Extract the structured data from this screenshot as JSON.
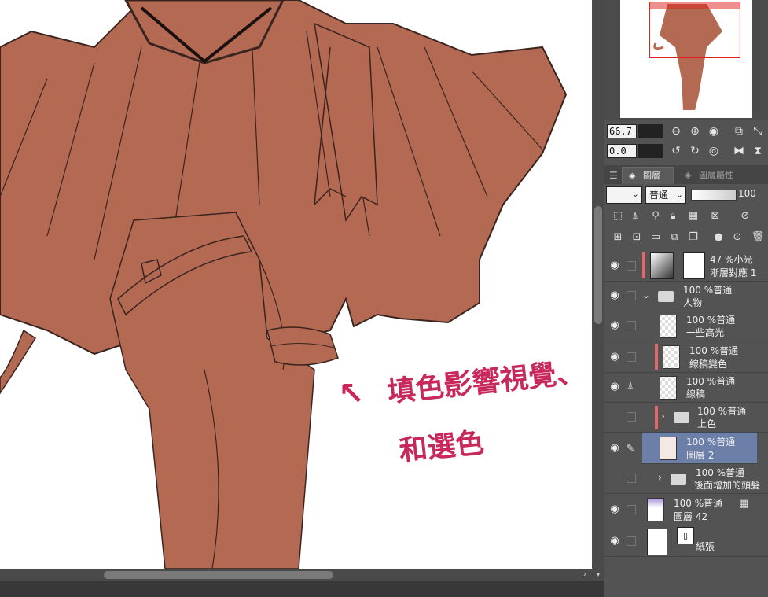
{
  "annotation": {
    "arrow": "↖",
    "line1": "填色影響視覺、",
    "line2": "和選色",
    "color": "#c8285a"
  },
  "navigator": {
    "zoom": "66.7",
    "rotation": "0.0"
  },
  "layer_panel": {
    "tab_layer": "圖層",
    "tab_props": "圖層屬性",
    "blend_mode": "普通",
    "opacity": "100"
  },
  "layers": [
    {
      "top": "47 %小光",
      "name": "漸層對應 1",
      "tag": true
    },
    {
      "top": "100 %普通",
      "name": "人物",
      "folder": true,
      "expanded": true
    },
    {
      "top": "100 %普通",
      "name": "一些高光"
    },
    {
      "top": "100 %普通",
      "name": "線稿變色",
      "tag": true
    },
    {
      "top": "100 %普通",
      "name": "線稿"
    },
    {
      "top": "100 %普通",
      "name": "上色",
      "folder": true,
      "tag": true
    },
    {
      "top": "100 %普通",
      "name": "圖層 2",
      "selected": true
    },
    {
      "top": "100 %普通",
      "name": "後面增加的頭髮",
      "folder": true
    },
    {
      "top": "100 %普通",
      "name": "圖層 42"
    },
    {
      "top": "",
      "name": "紙張"
    }
  ],
  "colors": {
    "skin": "#b46a52",
    "line": "#3a2420",
    "accent_red": "#e0201c",
    "selected_row": "#6b7fa8",
    "tag_red": "#e06a6a"
  }
}
